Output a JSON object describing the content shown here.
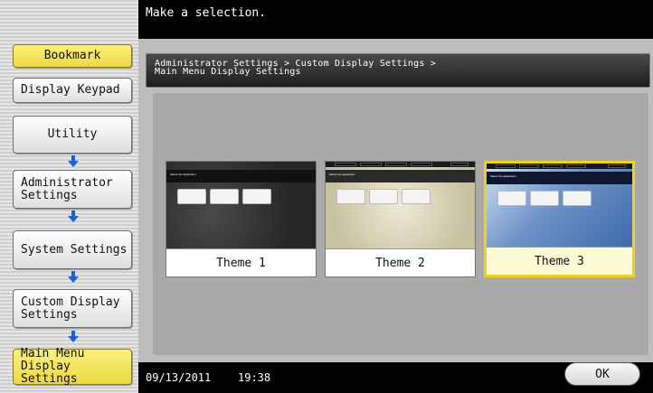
{
  "header": {
    "message": "Make a selection."
  },
  "sidebar": {
    "bookmark_label": "Bookmark",
    "display_keypad_label": "Display Keypad",
    "steps": [
      {
        "label": "Utility"
      },
      {
        "label": "Administrator\nSettings"
      },
      {
        "label": "System Settings"
      },
      {
        "label": "Custom Display\nSettings"
      },
      {
        "label": "Main Menu\nDisplay Settings"
      }
    ]
  },
  "breadcrumb": "Administrator Settings > Custom Display Settings >\nMain Menu Display Settings",
  "themes": [
    {
      "label": "Theme 1",
      "thumb_title": "Select the Application",
      "selected": false
    },
    {
      "label": "Theme 2",
      "thumb_title": "Select the Application",
      "selected": false
    },
    {
      "label": "Theme 3",
      "thumb_title": "Select the Application",
      "selected": true
    }
  ],
  "footer": {
    "date": "09/13/2011",
    "time": "19:38",
    "ok_label": "OK"
  },
  "colors": {
    "accent_yellow": "#f1d218",
    "arrow_blue": "#1f5fd6",
    "header_black": "#000000"
  },
  "icons": {
    "step_arrow": "arrow-down-icon"
  }
}
